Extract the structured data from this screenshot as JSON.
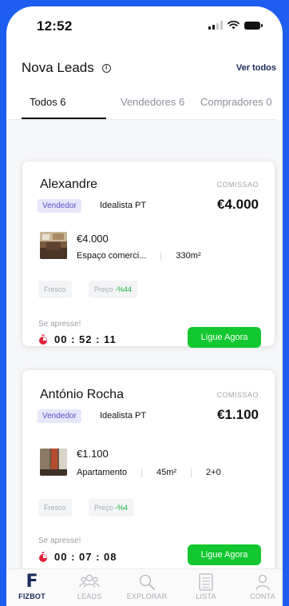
{
  "status_bar": {
    "time": "12:52"
  },
  "header": {
    "title": "Nova Leads",
    "see_all": "Ver todos"
  },
  "tabs": [
    {
      "label": "Todos 6",
      "active": true
    },
    {
      "label": "Vendedores 6",
      "active": false
    },
    {
      "label": "Compradores 0",
      "active": false
    }
  ],
  "leads": [
    {
      "name": "Alexandre",
      "commission_label": "COMISSAO",
      "commission": "€4.000",
      "role": "Vendedor",
      "source": "Idealista PT",
      "price": "€4.000",
      "type": "Espaço comerci...",
      "area": "330m²",
      "rooms": "",
      "tag_fresh": "Fresco",
      "price_tag_label": "Preço",
      "price_tag_value": "-%44",
      "hurry": "Se apresse!",
      "timer": "00 : 52 : 11",
      "call": "Ligue Agora"
    },
    {
      "name": "António Rocha",
      "commission_label": "COMISSAO",
      "commission": "€1.100",
      "role": "Vendedor",
      "source": "Idealista PT",
      "price": "€1.100",
      "type": "Apartamento",
      "area": "45m²",
      "rooms": "2+0",
      "tag_fresh": "Fresco",
      "price_tag_label": "Preço",
      "price_tag_value": "-%4",
      "hurry": "Se apresse!",
      "timer": "00 : 07 : 08",
      "call": "Ligue Agora"
    }
  ],
  "bottom_nav": [
    {
      "label": "FIZBOT",
      "icon": "fizbot-logo-icon",
      "active": true
    },
    {
      "label": "LEADS",
      "icon": "people-icon",
      "active": false
    },
    {
      "label": "EXPLORAR",
      "icon": "search-icon",
      "active": false
    },
    {
      "label": "LISTA",
      "icon": "list-icon",
      "active": false
    },
    {
      "label": "CONTA",
      "icon": "user-icon",
      "active": false
    }
  ],
  "colors": {
    "background": "#1d5ef0",
    "accent_green": "#12c72f",
    "badge": "#e7e6fb",
    "brand_navy": "#1a2a5a"
  }
}
